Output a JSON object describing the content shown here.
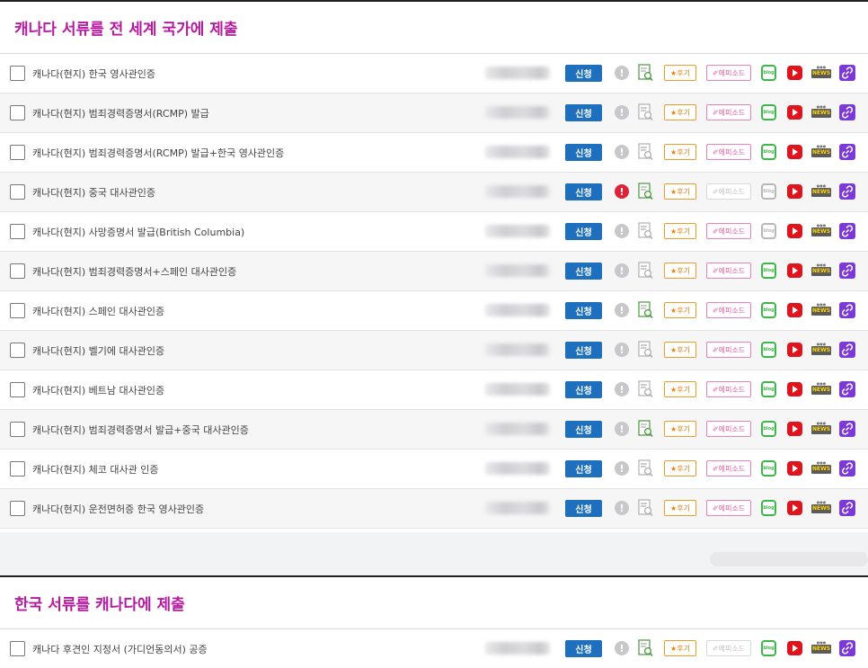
{
  "colors": {
    "title": "#b51aa0",
    "apply_button": "#1f6fbf",
    "alert": "#e02238",
    "link": "#7b39d6"
  },
  "section1": {
    "title": "캐나다 서류를 전 세계 국가에 제출",
    "rows": [
      {
        "label": "캐나다(현지) 한국 영사관인증",
        "apply": "신청",
        "review": "★후기",
        "episode": "✐에피소드",
        "blog": "blog",
        "news": "NEWS",
        "alert": false,
        "episode_dim": false,
        "blog_dim": false
      },
      {
        "label": "캐나다(현지) 범죄경력증명서(RCMP) 발급",
        "apply": "신청",
        "review": "★후기",
        "episode": "✐에피소드",
        "blog": "blog",
        "news": "NEWS",
        "alert": false,
        "episode_dim": false,
        "blog_dim": false
      },
      {
        "label": "캐나다(현지) 범죄경력증명서(RCMP) 발급+한국 영사관인증",
        "apply": "신청",
        "review": "★후기",
        "episode": "✐에피소드",
        "blog": "blog",
        "news": "NEWS",
        "alert": false,
        "episode_dim": false,
        "blog_dim": false
      },
      {
        "label": "캐나다(현지) 중국 대사관인증",
        "apply": "신청",
        "review": "★후기",
        "episode": "✐에피소드",
        "blog": "blog",
        "news": "NEWS",
        "alert": true,
        "episode_dim": true,
        "blog_dim": true
      },
      {
        "label": "캐나다(현지) 사망증명서 발급(British Columbia)",
        "apply": "신청",
        "review": "★후기",
        "episode": "✐에피소드",
        "blog": "blog",
        "news": "NEWS",
        "alert": false,
        "episode_dim": false,
        "blog_dim": true
      },
      {
        "label": "캐나다(현지) 범죄경력증명서+스페인 대사관인증",
        "apply": "신청",
        "review": "★후기",
        "episode": "✐에피소드",
        "blog": "blog",
        "news": "NEWS",
        "alert": false,
        "episode_dim": false,
        "blog_dim": false
      },
      {
        "label": "캐나다(현지) 스페인 대사관인증",
        "apply": "신청",
        "review": "★후기",
        "episode": "✐에피소드",
        "blog": "blog",
        "news": "NEWS",
        "alert": false,
        "episode_dim": false,
        "blog_dim": false
      },
      {
        "label": "캐나다(현지) 벨기에 대사관인증",
        "apply": "신청",
        "review": "★후기",
        "episode": "✐에피소드",
        "blog": "blog",
        "news": "NEWS",
        "alert": false,
        "episode_dim": false,
        "blog_dim": false
      },
      {
        "label": "캐나다(현지) 베트남 대사관인증",
        "apply": "신청",
        "review": "★후기",
        "episode": "✐에피소드",
        "blog": "blog",
        "news": "NEWS",
        "alert": false,
        "episode_dim": false,
        "blog_dim": false
      },
      {
        "label": "캐나다(현지) 범죄경력증명서 발급+중국 대사관인증",
        "apply": "신청",
        "review": "★후기",
        "episode": "✐에피소드",
        "blog": "blog",
        "news": "NEWS",
        "alert": false,
        "episode_dim": false,
        "blog_dim": false
      },
      {
        "label": "캐나다(현지) 체코 대사관 인증",
        "apply": "신청",
        "review": "★후기",
        "episode": "✐에피소드",
        "blog": "blog",
        "news": "NEWS",
        "alert": false,
        "episode_dim": false,
        "blog_dim": false
      },
      {
        "label": "캐나다(현지) 운전면허증 한국 영사관인증",
        "apply": "신청",
        "review": "★후기",
        "episode": "✐에피소드",
        "blog": "blog",
        "news": "NEWS",
        "alert": false,
        "episode_dim": false,
        "blog_dim": false
      }
    ]
  },
  "section2": {
    "title": "한국 서류를 캐나다에 제출",
    "rows": [
      {
        "label": "캐나다 후견인 지정서 (가디언동의서) 공증",
        "apply": "신청",
        "review": "★후기",
        "episode": "✐에피소드",
        "blog": "blog",
        "news": "NEWS",
        "alert": false,
        "episode_dim": true,
        "blog_dim": false
      }
    ]
  }
}
